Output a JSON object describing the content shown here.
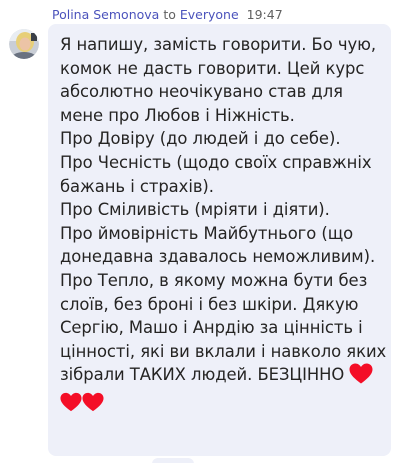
{
  "message": {
    "sender": "Polina Semonova",
    "to_word": "to",
    "recipient": "Everyone",
    "time": "19:47",
    "lines": [
      "Я напишу, замість говорити. Бо чую,",
      "комок не дасть говорити. Цей курс",
      "абсолютно неочікувано  став для",
      "мене про Любов і Ніжність.",
      "Про Довіру (до людей і до себе).",
      "Про Чесність (щодо своїх справжніх",
      "бажань і страхів).",
      "Про Сміливість (мріяти і діяти).",
      "Про ймовірність Майбутнього (що",
      "донедавна здавалось неможливим).",
      "Про Тепло, в якому можна бути без",
      "слоїв, без броні і без шкіри. Дякую",
      "Сергію, Машо і Анрдію за цінність  і",
      "цінності, які ви вклали і навколо яких"
    ],
    "last_line": "зібрали ТАКИХ людей. БЕЗЦІННО",
    "icons": {
      "trailing_heart": "red-heart-icon",
      "final_hearts": [
        "red-heart-icon",
        "red-heart-icon"
      ]
    }
  },
  "colors": {
    "name": "#4b53bc",
    "meta": "#616161",
    "bubble": "#eef0f9",
    "text": "#252423",
    "heart": "#f40e27"
  }
}
